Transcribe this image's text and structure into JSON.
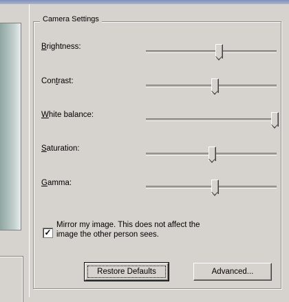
{
  "group": {
    "title": "Camera Settings"
  },
  "sliders": [
    {
      "label": "Brightness:",
      "value": 0.55
    },
    {
      "label": "Contrast:",
      "value": 0.52
    },
    {
      "label": "White balance:",
      "value": 0.98
    },
    {
      "label": "Saturation:",
      "value": 0.5
    },
    {
      "label": "Gamma:",
      "value": 0.52
    }
  ],
  "mirror": {
    "checked": true,
    "check_glyph": "✓",
    "text_line1": "Mirror my image.  This does not affect the",
    "text_line2": "image the other person sees."
  },
  "buttons": {
    "restore_label": "Restore Defaults",
    "advanced_label": "Advanced..."
  }
}
